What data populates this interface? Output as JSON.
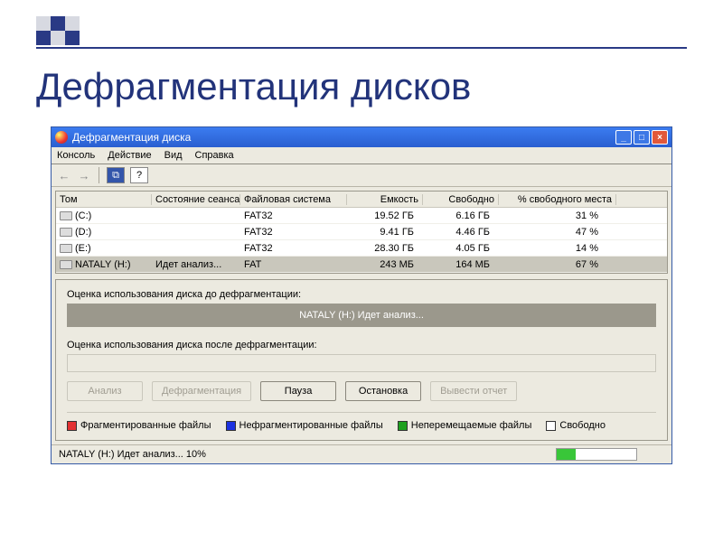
{
  "slide": {
    "heading": "Дефрагментация дисков"
  },
  "titlebar": {
    "app_name": "Дефрагментация диска"
  },
  "menu": {
    "console": "Консоль",
    "action": "Действие",
    "view": "Вид",
    "help": "Справка"
  },
  "toolbar": {
    "icon_btn1": "⧉",
    "icon_btn2": "?"
  },
  "grid": {
    "headers": {
      "vol": "Том",
      "state": "Состояние сеанса",
      "fs": "Файловая система",
      "cap": "Емкость",
      "free": "Свободно",
      "pct": "% свободного места"
    },
    "rows": [
      {
        "vol": "(C:)",
        "state": "",
        "fs": "FAT32",
        "cap": "19.52 ГБ",
        "free": "6.16 ГБ",
        "pct": "31 %"
      },
      {
        "vol": "(D:)",
        "state": "",
        "fs": "FAT32",
        "cap": "9.41 ГБ",
        "free": "4.46 ГБ",
        "pct": "47 %"
      },
      {
        "vol": "(E:)",
        "state": "",
        "fs": "FAT32",
        "cap": "28.30 ГБ",
        "free": "4.05 ГБ",
        "pct": "14 %"
      },
      {
        "vol": "NATALY (H:)",
        "state": "Идет анализ...",
        "fs": "FAT",
        "cap": "243 МБ",
        "free": "164 МБ",
        "pct": "67 %"
      }
    ]
  },
  "panel": {
    "before_label": "Оценка использования диска до дефрагментации:",
    "bar_text": "NATALY (H:) Идет анализ...",
    "after_label": "Оценка использования диска после дефрагментации:"
  },
  "buttons": {
    "analyze": "Анализ",
    "defrag": "Дефрагментация",
    "pause": "Пауза",
    "stop": "Остановка",
    "report": "Вывести отчет"
  },
  "legend": {
    "frag": "Фрагментированные файлы",
    "nofrag": "Нефрагментированные файлы",
    "immov": "Неперемещаемые файлы",
    "free": "Свободно"
  },
  "status": {
    "text": "NATALY (H:) Идет анализ... 10%"
  }
}
